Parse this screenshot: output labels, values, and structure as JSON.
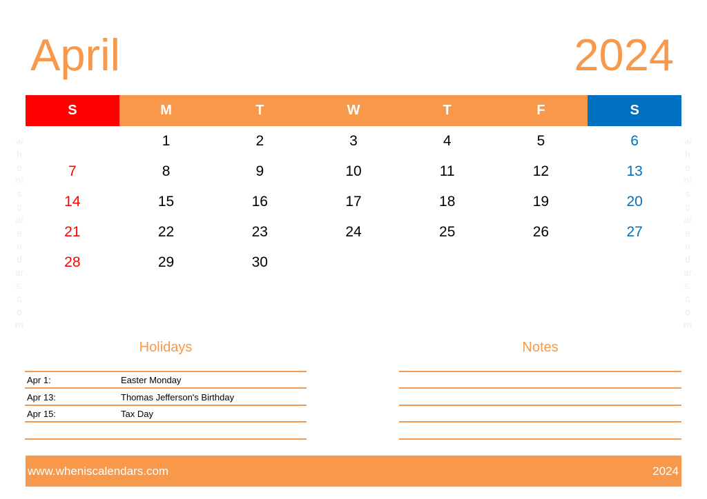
{
  "header": {
    "month": "April",
    "year": "2024"
  },
  "colors": {
    "accent": "#f7984a",
    "sunday": "#ff0000",
    "saturday": "#0070c0",
    "weekday_text": "#000000"
  },
  "weekdays": [
    {
      "label": "S",
      "type": "sun"
    },
    {
      "label": "M",
      "type": "weekday"
    },
    {
      "label": "T",
      "type": "weekday"
    },
    {
      "label": "W",
      "type": "weekday"
    },
    {
      "label": "T",
      "type": "weekday"
    },
    {
      "label": "F",
      "type": "weekday"
    },
    {
      "label": "S",
      "type": "sat"
    }
  ],
  "weeks": [
    [
      "",
      "1",
      "2",
      "3",
      "4",
      "5",
      "6"
    ],
    [
      "7",
      "8",
      "9",
      "10",
      "11",
      "12",
      "13"
    ],
    [
      "14",
      "15",
      "16",
      "17",
      "18",
      "19",
      "20"
    ],
    [
      "21",
      "22",
      "23",
      "24",
      "25",
      "26",
      "27"
    ],
    [
      "28",
      "29",
      "30",
      "",
      "",
      "",
      ""
    ]
  ],
  "watermark": [
    "w",
    "h",
    "e",
    "ni",
    "s",
    "c",
    "al",
    "e",
    "n",
    "d",
    "ar",
    "s.",
    "c",
    "o",
    "m"
  ],
  "holidays": {
    "title": "Holidays",
    "items": [
      {
        "date": "Apr 1:",
        "name": "Easter Monday"
      },
      {
        "date": "Apr 13:",
        "name": "Thomas Jefferson's Birthday"
      },
      {
        "date": "Apr 15:",
        "name": "Tax Day"
      }
    ]
  },
  "notes": {
    "title": "Notes"
  },
  "footer": {
    "url": "www.wheniscalendars.com",
    "year": "2024"
  }
}
